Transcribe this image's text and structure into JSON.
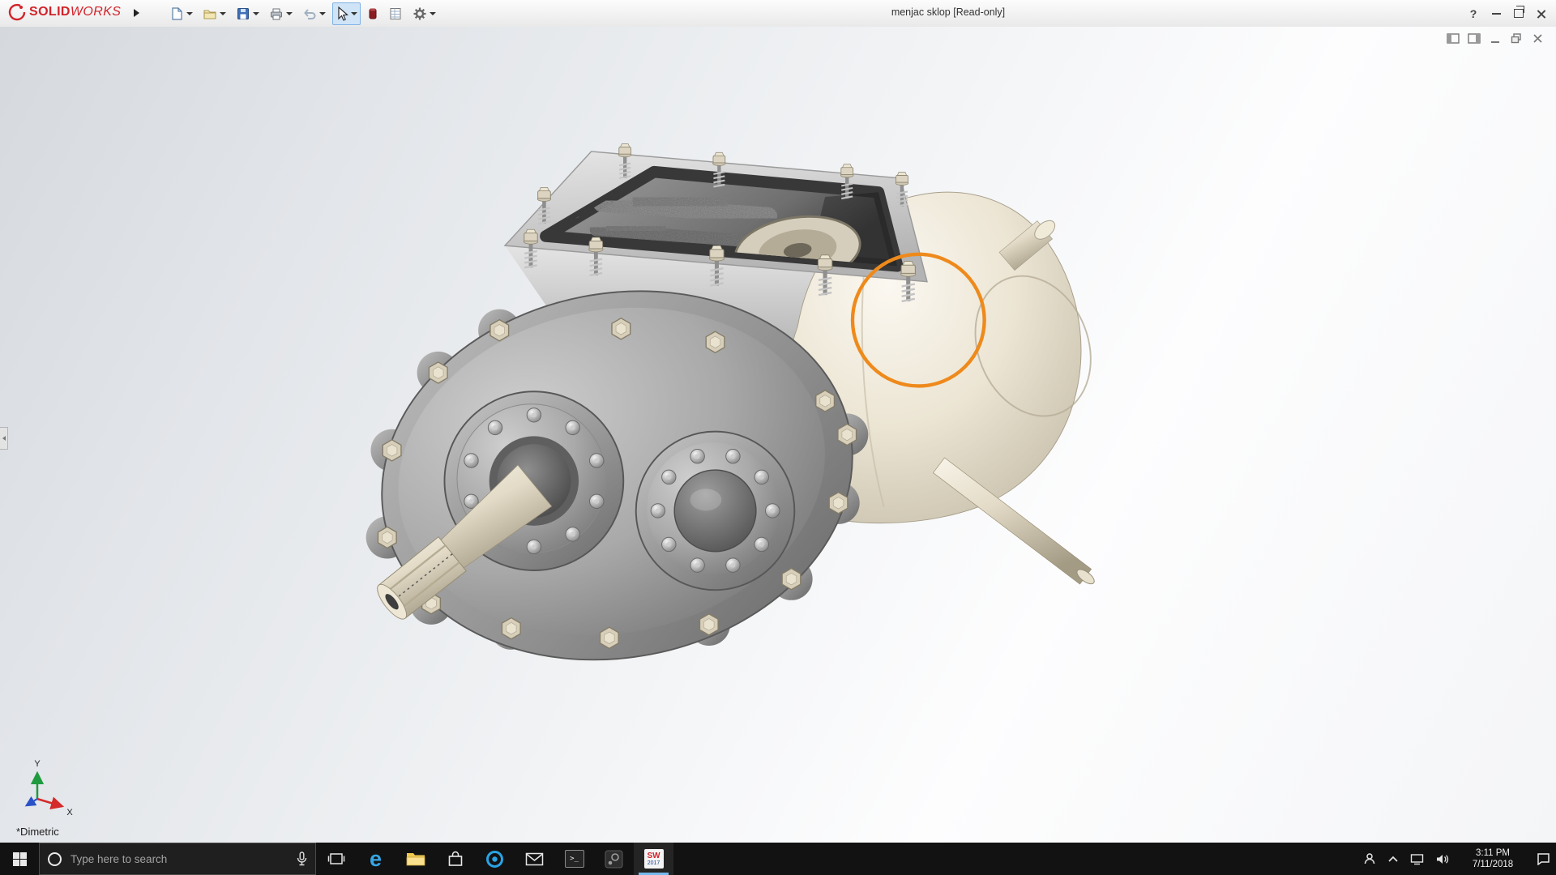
{
  "colors": {
    "brand_red": "#d2232a",
    "annotation_orange": "#ee8a1c",
    "selection_blue": "#cfe4f7",
    "taskbar_bg": "#121212"
  },
  "titlebar": {
    "brand": {
      "prefix": "SOLID",
      "suffix": "WORKS"
    },
    "document_title": "menjac sklop [Read-only]",
    "help_label": "?"
  },
  "toolbar": {
    "buttons": [
      "new-document",
      "open",
      "save",
      "print",
      "undo",
      "select",
      "solidworks-resources",
      "evaluate-sheet",
      "options"
    ]
  },
  "document_window": {
    "controls": [
      "pane-left",
      "pane-right",
      "minimize",
      "restore",
      "close"
    ]
  },
  "viewport": {
    "view_orientation_label": "*Dimetric",
    "triad": {
      "x": "X",
      "y": "Y"
    },
    "annotation": {
      "type": "circle",
      "color": "#ee8a1c"
    }
  },
  "taskbar": {
    "search_placeholder": "Type here to search",
    "edge_glyph": "e",
    "cmd_glyph": ">_",
    "solidworks_badge": {
      "label": "SW",
      "year": "2017"
    },
    "apps": [
      "task-view",
      "edge",
      "file-explorer",
      "store",
      "cortana",
      "mail",
      "command-prompt",
      "steam",
      "solidworks-2017"
    ],
    "clock": {
      "time": "3:11 PM",
      "date": "7/11/2018"
    }
  }
}
